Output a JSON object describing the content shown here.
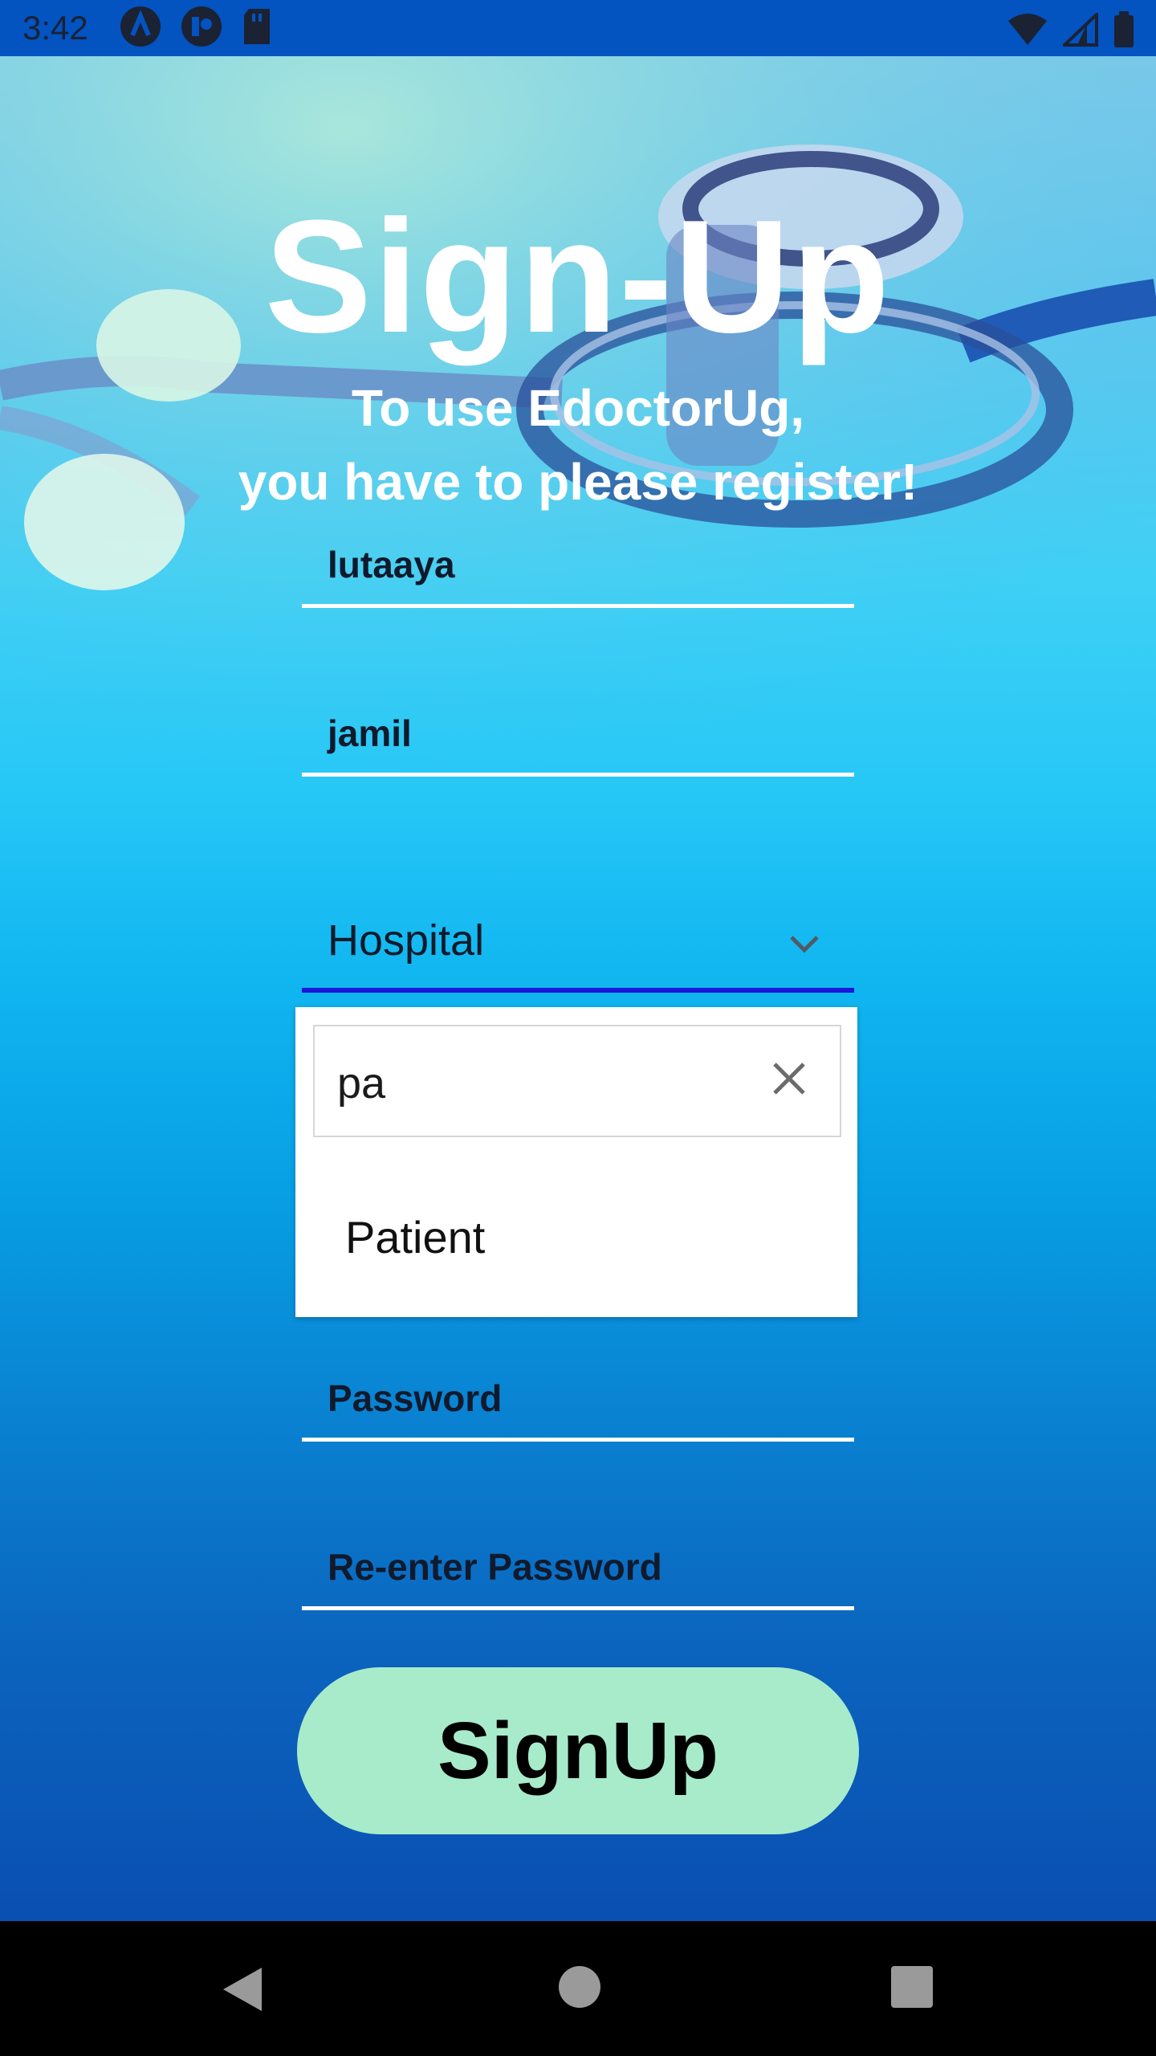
{
  "status_bar": {
    "time": "3:42",
    "left_icons": [
      "android-studio-icon",
      "app-notification-icon",
      "sd-card-icon"
    ],
    "right_icons": [
      "wifi-icon",
      "cell-signal-icon",
      "battery-icon"
    ]
  },
  "header": {
    "title": "Sign-Up",
    "subtitle_line1": "To use EdoctorUg,",
    "subtitle_line2": "you have to please register!"
  },
  "form": {
    "first_name_value": "lutaaya",
    "last_name_value": "jamil",
    "category_select": "Hospital",
    "password_placeholder": "Password",
    "reenter_password_placeholder": "Re-enter Password",
    "submit_label": "SignUp"
  },
  "dropdown": {
    "search_value": "pa",
    "options": [
      "Patient"
    ]
  },
  "nav_bar": {
    "buttons": [
      "back-icon",
      "home-icon",
      "recents-icon"
    ]
  },
  "colors": {
    "status_bar": "#0353c1",
    "button": "#a7ebcb",
    "select_underline": "#1818d6"
  }
}
